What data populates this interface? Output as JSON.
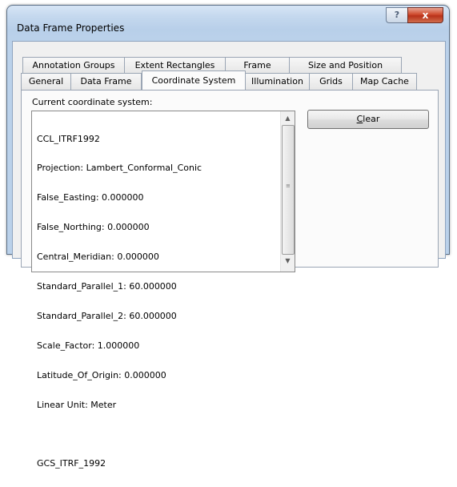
{
  "window": {
    "title": "Data Frame Properties",
    "help_label": "?",
    "close_label": "x"
  },
  "tabs": {
    "row1": [
      "Annotation Groups",
      "Extent Rectangles",
      "Frame",
      "Size and Position"
    ],
    "row2": [
      "General",
      "Data Frame",
      "Coordinate System",
      "Illumination",
      "Grids",
      "Map Cache"
    ],
    "active": "Coordinate System"
  },
  "coordinate_system": {
    "label": "Current coordinate system:",
    "lines": [
      "CCL_ITRF1992",
      "Projection: Lambert_Conformal_Conic",
      "False_Easting: 0.000000",
      "False_Northing: 0.000000",
      "Central_Meridian: 0.000000",
      "Standard_Parallel_1: 60.000000",
      "Standard_Parallel_2: 60.000000",
      "Scale_Factor: 1.000000",
      "Latitude_Of_Origin: 0.000000",
      "Linear Unit: Meter",
      "",
      "GCS_ITRF_1992"
    ]
  },
  "buttons": {
    "clear_label": "Clear",
    "clear_mnemonic": "C",
    "clear_rest": "lear"
  },
  "colors": {
    "title_bar": "#c4d8ee",
    "close_button": "#cf4a2d",
    "dialog_bg": "#f0f0f0"
  }
}
